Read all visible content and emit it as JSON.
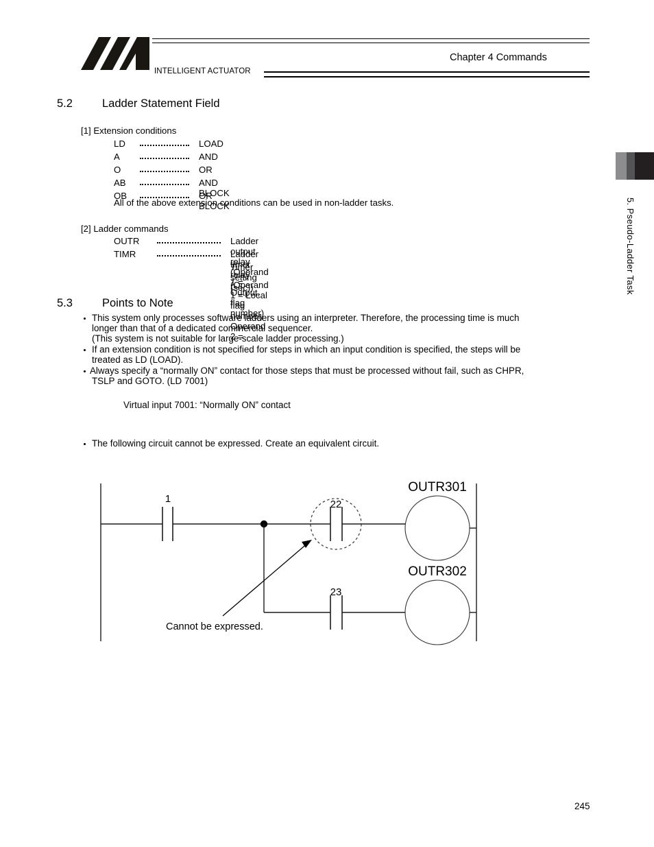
{
  "header": {
    "company": "INTELLIGENT ACTUATOR",
    "chapter": "Chapter 4   Commands",
    "logo_alt": "IA logo"
  },
  "side_tab": {
    "label": "5. Pseudo-Ladder Task"
  },
  "sections": {
    "s52": {
      "number": "5.2",
      "title": "Ladder Statement Field"
    },
    "s53": {
      "number": "5.3",
      "title": "Points to Note"
    }
  },
  "extension_conditions": {
    "heading": "[1]  Extension conditions",
    "rows": [
      {
        "abbr": "LD",
        "desc": "LOAD"
      },
      {
        "abbr": "A",
        "desc": "AND"
      },
      {
        "abbr": "O",
        "desc": "OR"
      },
      {
        "abbr": "AB",
        "desc": "AND BLOCK"
      },
      {
        "abbr": "OB",
        "desc": "OR BLOCK"
      }
    ],
    "note": "All of the above extension conditions can be used in non-ladder tasks."
  },
  "ladder_commands": {
    "heading": "[2]  Ladder commands",
    "rows": [
      {
        "abbr": "OUTR",
        "desc": "Ladder output relay (Operand 1 = Output, flag number)",
        "desc2": ""
      },
      {
        "abbr": "TIMR",
        "desc": "Ladder timer relay (Operand 1 = Local flag number, Operand 2 =",
        "desc2": "Timer setting (sec))"
      }
    ]
  },
  "points_to_note": {
    "bullets": [
      {
        "lines": [
          "This system only processes software ladders using an interpreter. Therefore, the processing time is much",
          "longer than that of a dedicated commercial sequencer.",
          "(This system is not suitable for large-scale ladder processing.)"
        ]
      },
      {
        "lines": [
          "If an extension condition is not specified for steps in which an input condition is specified, the steps will be",
          "treated as LD (LOAD)."
        ]
      },
      {
        "lines": [
          "Always specify a “normally ON” contact for those steps that must be processed without fail, such as CHPR,",
          "TSLP and GOTO. (LD 7001)"
        ]
      }
    ],
    "sub_note": "Virtual input 7001: “Normally ON” contact",
    "figure_intro": "The following circuit cannot be expressed. Create an equivalent circuit."
  },
  "ladder_figure": {
    "contact_1_label": "1",
    "contact_22_label": "22",
    "contact_23_label": "23",
    "coil_1_label": "OUTR301",
    "coil_2_label": "OUTR302",
    "annotation": "Cannot be expressed."
  },
  "footer": {
    "page_number": "245"
  },
  "colors": {
    "ink": "#000000",
    "tab_light": "#8d8d8f",
    "tab_mid": "#545456",
    "tab_dark": "#231f20",
    "line": "#1a1a1a"
  }
}
